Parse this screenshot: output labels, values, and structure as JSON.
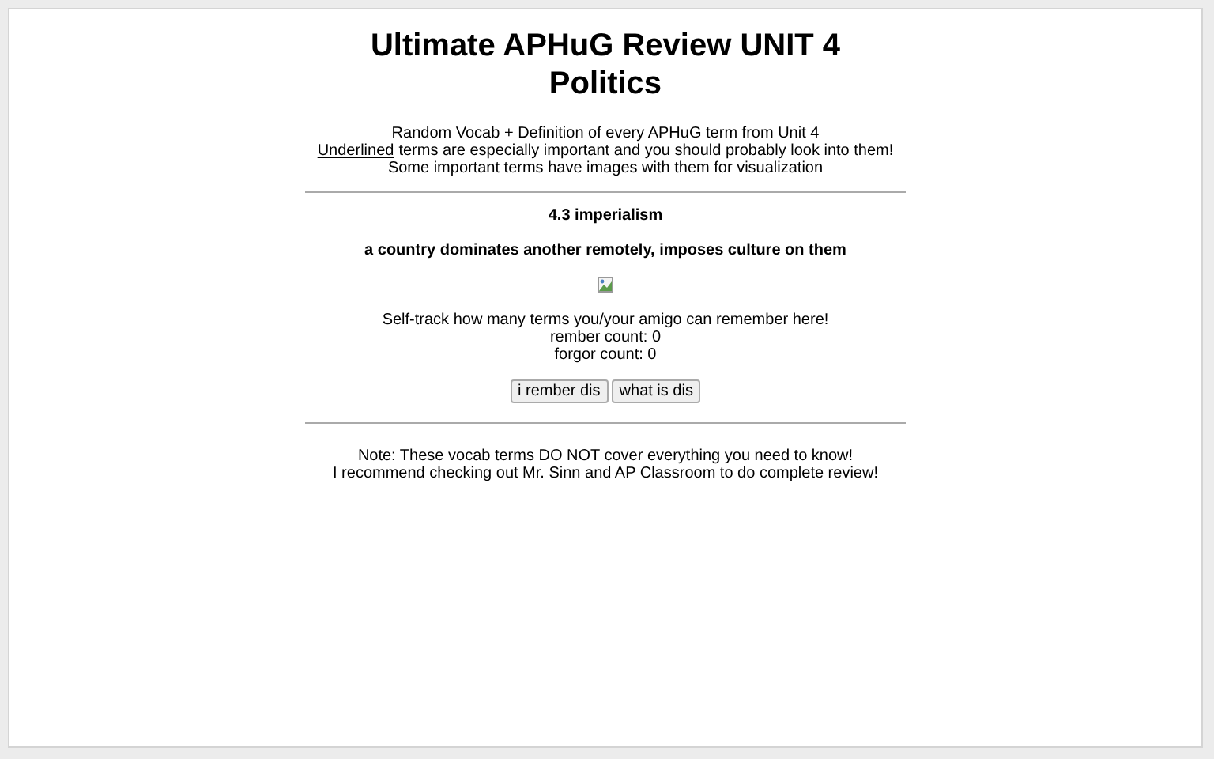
{
  "title": "Ultimate APHuG Review UNIT 4 Politics",
  "intro": {
    "line_1": "Random Vocab + Definition of every APHuG term from Unit 4",
    "underlined_word": "Underlined",
    "line_2_rest": "terms are especially important and you should probably look into them!",
    "line_3": "Some important terms have images with them for visualization"
  },
  "term": {
    "name": "4.3 imperialism",
    "definition": "a country dominates another remotely, imposes culture on them",
    "image": {
      "kind": "broken-image"
    }
  },
  "tracker": {
    "prompt": "Self-track how many terms you/your amigo can remember here!",
    "counts": [
      "rember count: 0",
      "forgor count: 0"
    ]
  },
  "buttons": [
    "i rember dis",
    "what is dis"
  ],
  "note": [
    "Note: These vocab terms DO NOT cover everything you need to know!",
    "I recommend checking out Mr. Sinn and AP Classroom to do complete review!"
  ]
}
